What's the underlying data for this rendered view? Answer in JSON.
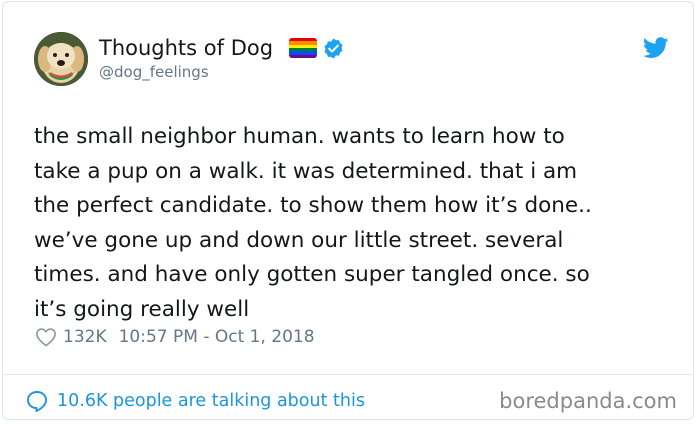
{
  "author": {
    "display_name": "Thoughts of Dog",
    "handle": "@dog_feelings",
    "avatar_icon": "dog-avatar",
    "flag_icon": "rainbow-flag-icon",
    "verified_icon": "verified-badge-icon"
  },
  "tweet": {
    "lines": [
      "the small neighbor human. wants to learn how to",
      "take a pup on a walk. it was determined. that i am",
      "the perfect candidate. to show them how it’s done..",
      "we’ve gone up and down our little street. several",
      "times. and have only gotten super tangled once. so",
      "it’s going really well"
    ],
    "likes": "132K",
    "timestamp": "10:57 PM - Oct 1, 2018"
  },
  "footer": {
    "talking": "10.6K people are talking about this",
    "watermark": "boredpanda.com"
  },
  "colors": {
    "twitter_blue": "#1da1f2",
    "link_blue": "#1b95e0",
    "muted": "#657786",
    "text": "#14171a"
  }
}
